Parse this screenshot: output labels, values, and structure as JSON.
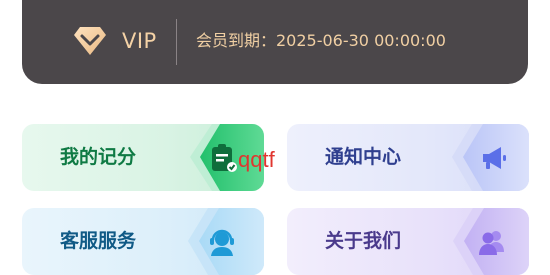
{
  "vip": {
    "label": "VIP",
    "expire_text": "会员到期：2025-06-30 00:00:00",
    "badge_icon": "diamond-shield-icon"
  },
  "tiles": [
    {
      "label": "我的记分",
      "icon": "clipboard-check-icon",
      "accent": "#2fbf6b"
    },
    {
      "label": "通知中心",
      "icon": "megaphone-icon",
      "accent": "#5b6fe8"
    },
    {
      "label": "客服服务",
      "icon": "customer-service-icon",
      "accent": "#1f9ad6"
    },
    {
      "label": "关于我们",
      "icon": "users-icon",
      "accent": "#8a6be8"
    }
  ],
  "watermark": {
    "text": "qqtf"
  }
}
